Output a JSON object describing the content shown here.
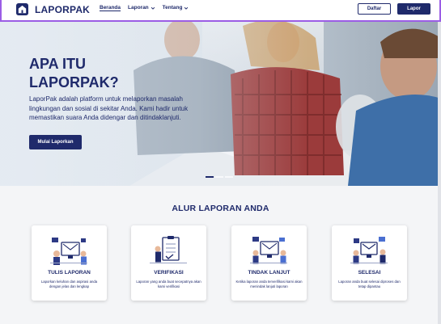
{
  "nav": {
    "brand": "LAPORPAK",
    "links": [
      {
        "label": "Beranda"
      },
      {
        "label": "Laporan"
      },
      {
        "label": "Tentang"
      }
    ],
    "register_label": "Daftar",
    "report_label": "Lapor"
  },
  "hero": {
    "title_line1": "APA ITU",
    "title_line2": "LAPORPAK?",
    "description": "LaporPak adalah platform untuk melaporkan masalah lingkungan dan sosial di sekitar Anda. Kami hadir untuk memastikan suara Anda didengar dan ditindaklanjuti.",
    "cta_label": "Mulai Laporkan"
  },
  "flow": {
    "title": "ALUR LAPORAN ANDA",
    "steps": [
      {
        "title": "TULIS LAPORAN",
        "desc": "Laporkan keluhan dan aspirasi anda dengan jelas dan lengkap"
      },
      {
        "title": "VERIFIKASI",
        "desc": "Laporan yang anda buat secepatnya akan kami verifikasi"
      },
      {
        "title": "TINDAK LANJUT",
        "desc": "Ketika laporan anda terverifikasi kami akan menindak lanjuti laporan"
      },
      {
        "title": "SELESAI",
        "desc": "Laporan anda buat selesai diproses dan tetap dipantau"
      }
    ]
  },
  "colors": {
    "primary": "#1f2a6b",
    "accent_border": "#9b5de5"
  }
}
